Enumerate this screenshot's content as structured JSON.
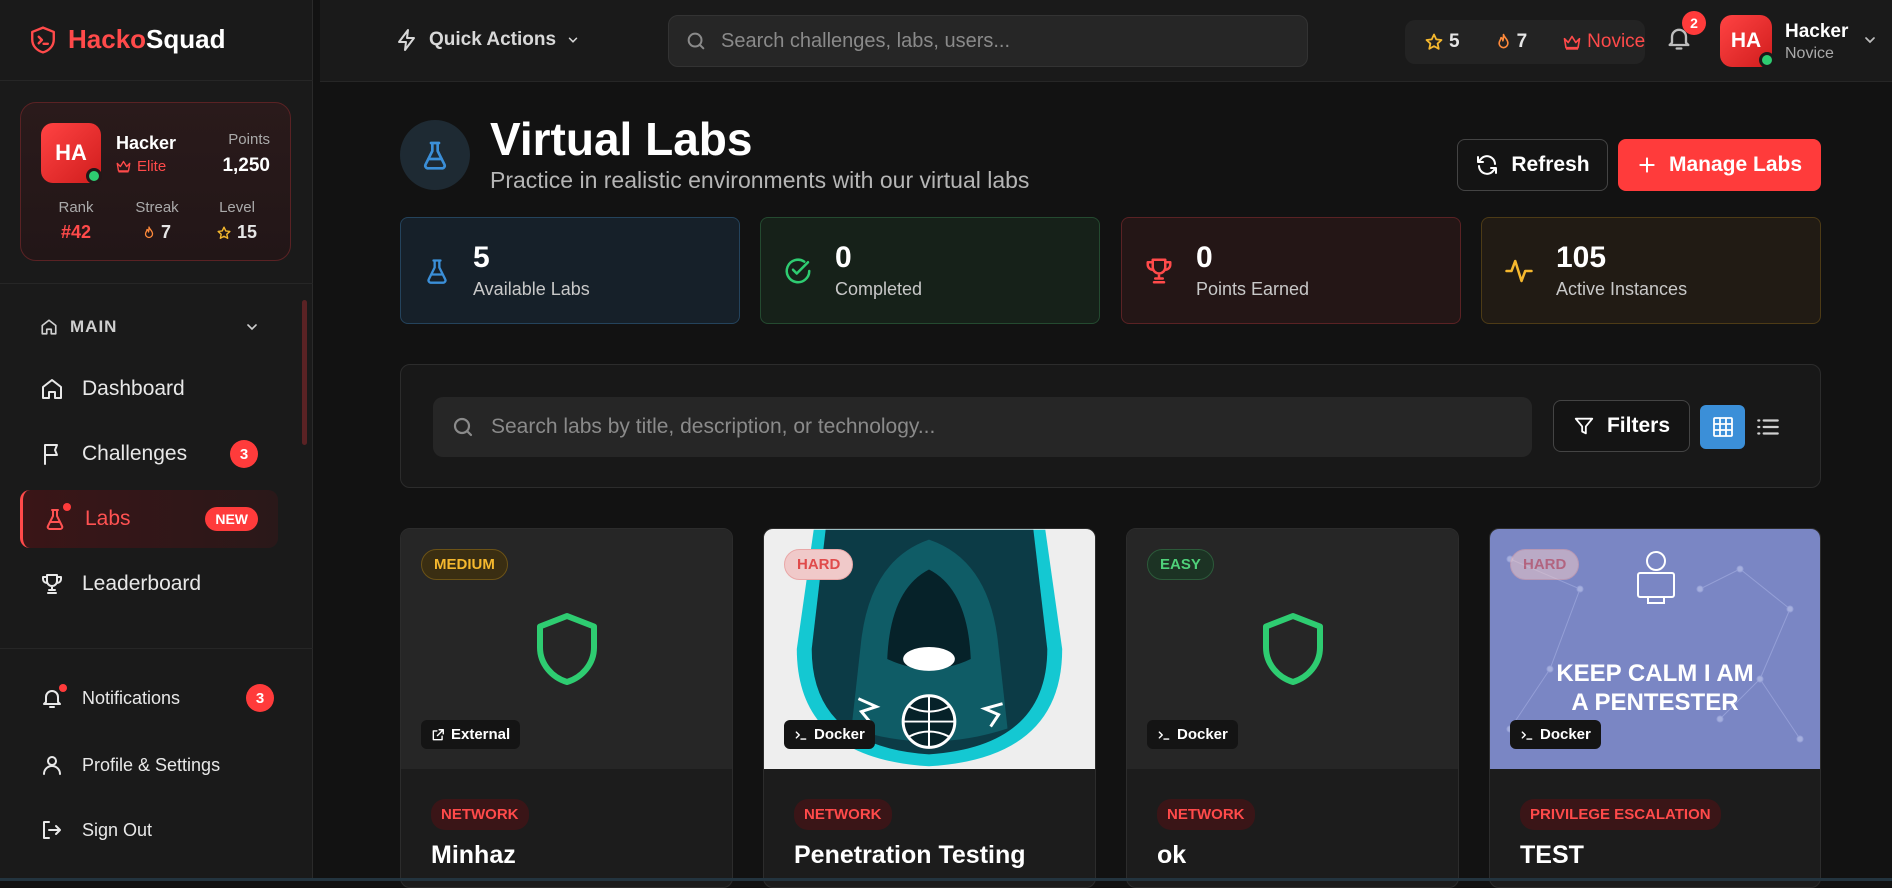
{
  "brand": {
    "part1": "Hacko",
    "part2": "Squad"
  },
  "profile": {
    "initials": "HA",
    "name": "Hacker",
    "rank_title": "Elite",
    "points_label": "Points",
    "points_value": "1,250",
    "stats": [
      {
        "label": "Rank",
        "value": "#42"
      },
      {
        "label": "Streak",
        "value": "7"
      },
      {
        "label": "Level",
        "value": "15"
      }
    ]
  },
  "nav": {
    "section": "MAIN",
    "items": [
      {
        "label": "Dashboard"
      },
      {
        "label": "Challenges",
        "badge": "3"
      },
      {
        "label": "Labs",
        "badge": "NEW"
      },
      {
        "label": "Leaderboard"
      }
    ],
    "footer": [
      {
        "label": "Notifications",
        "badge": "3"
      },
      {
        "label": "Profile & Settings"
      },
      {
        "label": "Sign Out"
      }
    ]
  },
  "topbar": {
    "quick_actions": "Quick Actions",
    "search_placeholder": "Search challenges, labs, users...",
    "stars": "5",
    "streak": "7",
    "rank": "Novice",
    "notif_count": "2",
    "user_initials": "HA",
    "user_name": "Hacker",
    "user_role": "Novice"
  },
  "page": {
    "title": "Virtual Labs",
    "subtitle": "Practice in realistic environments with our virtual labs",
    "refresh": "Refresh",
    "manage": "Manage Labs"
  },
  "stats": [
    {
      "value": "5",
      "label": "Available Labs",
      "color": "#3b8fd8"
    },
    {
      "value": "0",
      "label": "Completed",
      "color": "#2ecc71"
    },
    {
      "value": "0",
      "label": "Points Earned",
      "color": "#ff4a4a"
    },
    {
      "value": "105",
      "label": "Active Instances",
      "color": "#f5b82e"
    }
  ],
  "filters": {
    "search_placeholder": "Search labs by title, description, or technology...",
    "filters_label": "Filters"
  },
  "labs": [
    {
      "difficulty": "MEDIUM",
      "type": "External",
      "category": "NETWORK",
      "title": "Minhaz"
    },
    {
      "difficulty": "HARD",
      "type": "Docker",
      "category": "NETWORK",
      "title": "Penetration Testing"
    },
    {
      "difficulty": "EASY",
      "type": "Docker",
      "category": "NETWORK",
      "title": "ok"
    },
    {
      "difficulty": "HARD",
      "type": "Docker",
      "category": "PRIVILEGE ESCALATION",
      "title": "TEST",
      "poster": "KEEP CALM I AM A PENTESTER"
    }
  ],
  "colors": {
    "accent": "#ff3b3b",
    "success": "#2ecc71",
    "info": "#3b8fd8",
    "warning": "#f5b82e"
  }
}
